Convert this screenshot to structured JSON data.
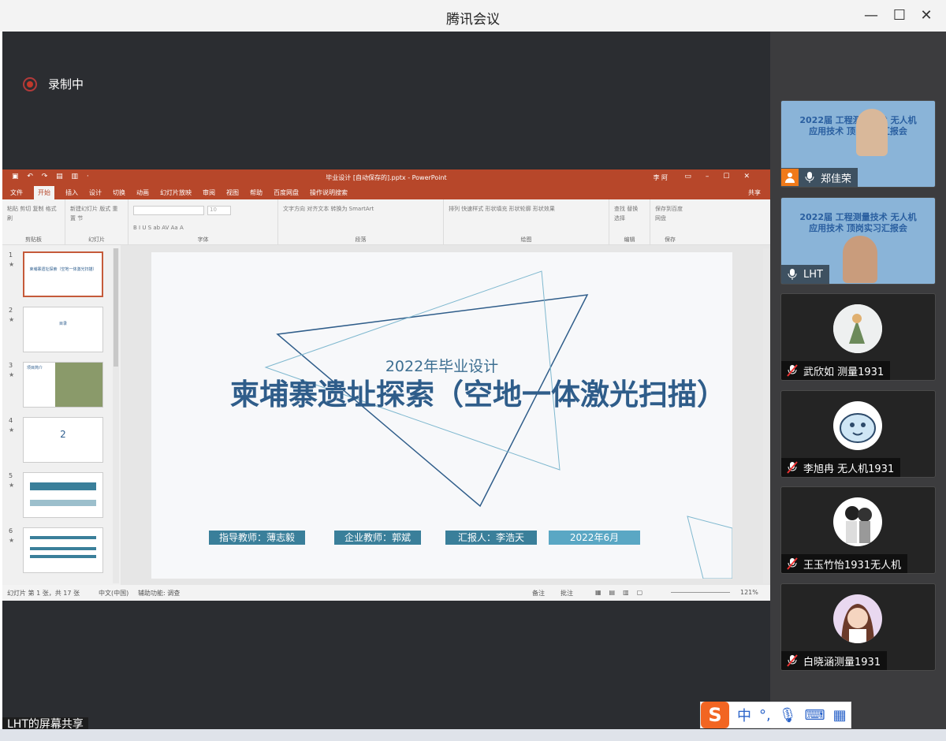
{
  "window": {
    "title": "腾讯会议"
  },
  "recording": {
    "label": "录制中"
  },
  "ppt": {
    "doc_title": "毕业设计 [自动保存的].pptx - PowerPoint",
    "user": "李 阿",
    "share_label": "共享",
    "menu": [
      "文件",
      "开始",
      "插入",
      "设计",
      "切换",
      "动画",
      "幻灯片放映",
      "审阅",
      "视图",
      "帮助",
      "百度网盘",
      "操作说明搜索"
    ],
    "ribbon_groups": [
      {
        "label": "剪贴板",
        "items": "粘贴  剪切 复制 格式刷"
      },
      {
        "label": "幻灯片",
        "items": "新建幻灯片  版式 重置 节"
      },
      {
        "label": "字体",
        "items": "B I U S ab AV Aa A"
      },
      {
        "label": "段落",
        "items": "文字方向  对齐文本  转换为 SmartArt"
      },
      {
        "label": "绘图",
        "items": "排列  快速样式  形状填充 形状轮廓 形状效果"
      },
      {
        "label": "编辑",
        "items": "查找 替换 选择"
      },
      {
        "label": "保存",
        "items": "保存到百度网盘"
      }
    ],
    "font_size": "10",
    "thumbnails": [
      {
        "num": "1",
        "text": "束埔寨遗址探索（空地一体激光扫描）"
      },
      {
        "num": "2",
        "text": "目录"
      },
      {
        "num": "3",
        "text": "项目简介"
      },
      {
        "num": "4",
        "text": "2"
      },
      {
        "num": "5",
        "text": ""
      },
      {
        "num": "6",
        "text": ""
      }
    ],
    "slide": {
      "subtitle": "2022年毕业设计",
      "title": "柬埔寨遗址探索（空地一体激光扫描）",
      "tags": [
        "指导教师：薄志毅",
        "企业教师：郭斌",
        "汇报人：李浩天",
        "2022年6月"
      ]
    },
    "status": {
      "slide_count": "幻灯片 第 1 张，共 17 张",
      "language": "中文(中国)",
      "accessibility": "辅助功能: 调查",
      "notes": "备注",
      "comments": "批注",
      "zoom": "121%"
    }
  },
  "participants": [
    {
      "name": "郑佳荣",
      "video": true,
      "muted": false,
      "host": true,
      "banner": "2022届 工程测量技术 无人机应用技术 顶岗实习汇报会"
    },
    {
      "name": "LHT",
      "video": true,
      "muted": false,
      "host": false,
      "banner": "2022届 工程测量技术 无人机应用技术 顶岗实习汇报会"
    },
    {
      "name": "武欣如 测量1931",
      "video": false,
      "muted": true,
      "avatar": "figure"
    },
    {
      "name": "李旭冉 无人机1931",
      "video": false,
      "muted": true,
      "avatar": "cartoon"
    },
    {
      "name": "王玉竹怡1931无人机",
      "video": false,
      "muted": true,
      "avatar": "couple"
    },
    {
      "name": "白晓涵测量1931",
      "video": false,
      "muted": true,
      "avatar": "girl"
    }
  ],
  "share_label": "LHT的屏幕共享",
  "ime": {
    "mode": "中",
    "punct": "°,"
  },
  "colors": {
    "ppt_accent": "#b7472a",
    "slide_title": "#2f5d8a",
    "tag_bg": "#3a7f9a",
    "host": "#f07a1a"
  }
}
